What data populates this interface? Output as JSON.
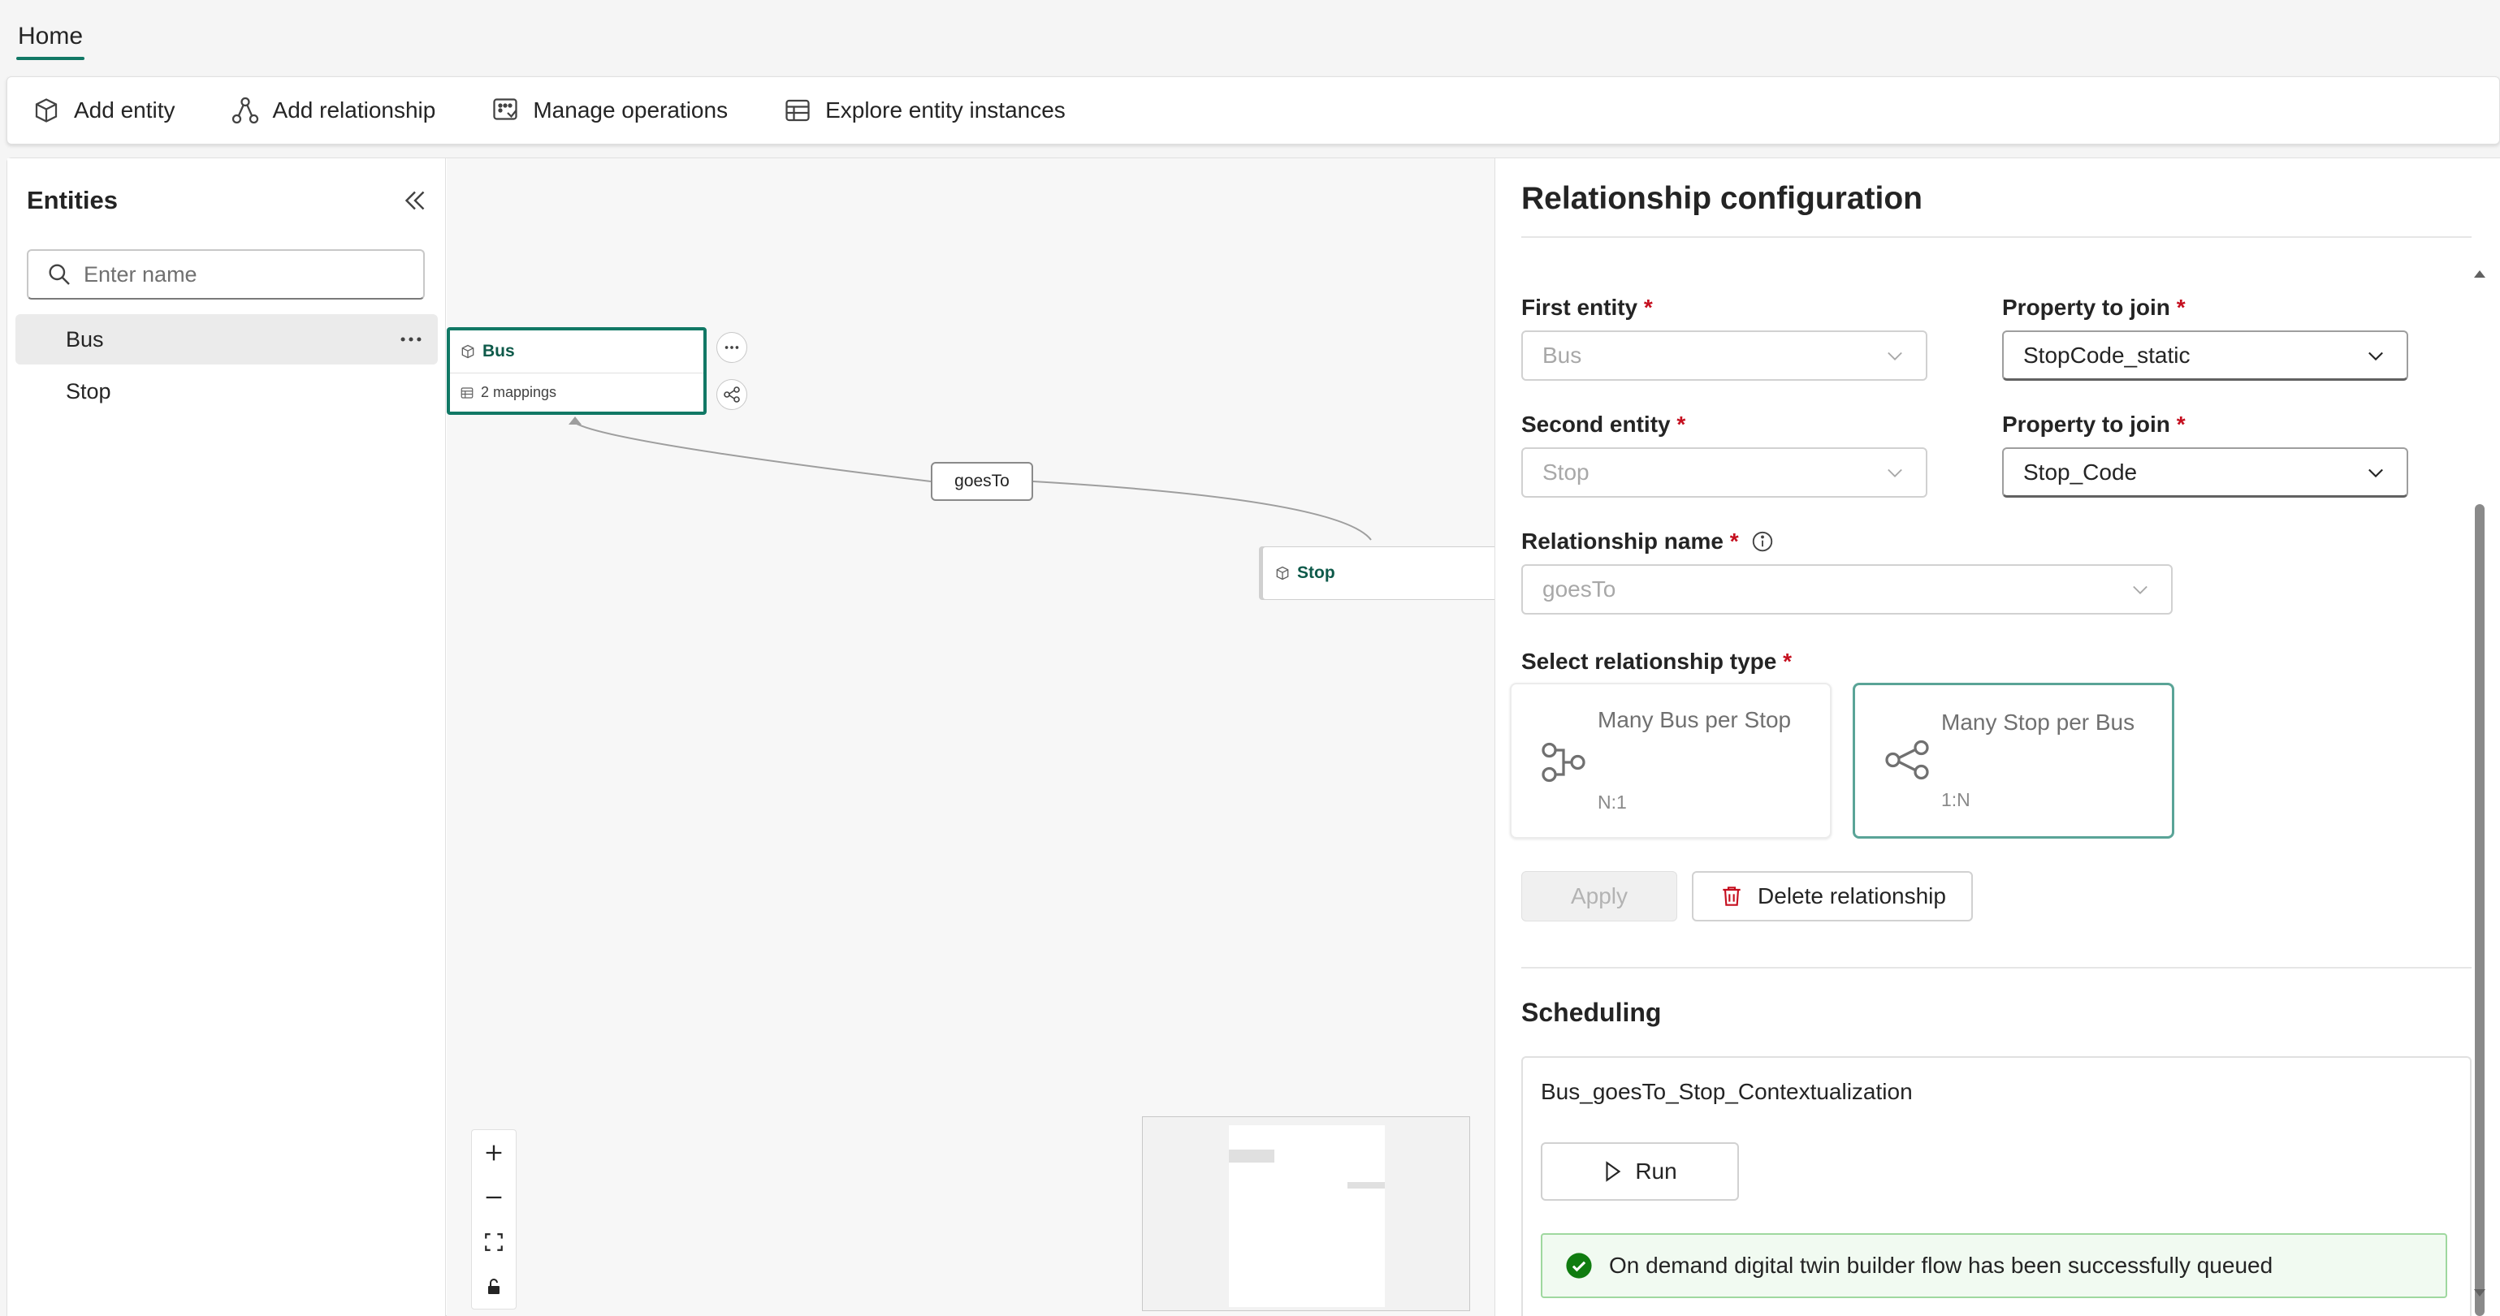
{
  "tabs": {
    "home": "Home"
  },
  "toolbar": {
    "add_entity": "Add entity",
    "add_relationship": "Add relationship",
    "manage_operations": "Manage operations",
    "explore_instances": "Explore entity instances"
  },
  "sidebar": {
    "title": "Entities",
    "search_placeholder": "Enter name",
    "items": [
      {
        "label": "Bus"
      },
      {
        "label": "Stop"
      }
    ]
  },
  "canvas": {
    "bus_node": {
      "title": "Bus",
      "subtitle": "2 mappings"
    },
    "stop_node": {
      "title": "Stop"
    },
    "edge_label": "goesTo"
  },
  "panel": {
    "title": "Relationship configuration",
    "first_entity": {
      "label": "First entity",
      "value": "Bus"
    },
    "first_property": {
      "label": "Property to join",
      "value": "StopCode_static"
    },
    "second_entity": {
      "label": "Second entity",
      "value": "Stop"
    },
    "second_property": {
      "label": "Property to join",
      "value": "Stop_Code"
    },
    "relationship_name": {
      "label": "Relationship name",
      "value": "goesTo"
    },
    "relationship_type_label": "Select relationship type",
    "rel_types": [
      {
        "title": "Many Bus per Stop",
        "sub": "N:1"
      },
      {
        "title": "Many Stop per Bus",
        "sub": "1:N"
      }
    ],
    "required_mark": "*",
    "apply_label": "Apply",
    "delete_label": "Delete relationship",
    "scheduling": {
      "title": "Scheduling",
      "job_name": "Bus_goesTo_Stop_Contextualization",
      "run_label": "Run",
      "toast": "On demand digital twin builder flow has been successfully queued"
    }
  },
  "colors": {
    "accent": "#117865",
    "required": "#c50f1f",
    "success": "#107c10"
  }
}
